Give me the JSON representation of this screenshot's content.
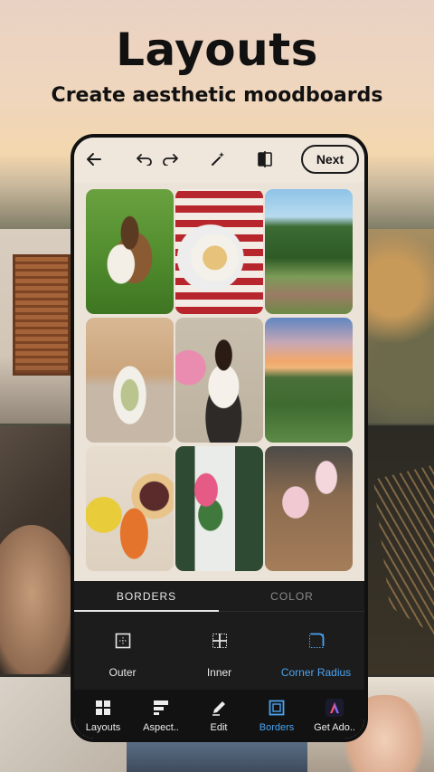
{
  "headline": "Layouts",
  "subheadline": "Create aesthetic moodboards",
  "toolbar": {
    "back_icon": "arrow-left-icon",
    "undo_icon": "undo-icon",
    "redo_icon": "redo-icon",
    "magic_icon": "magic-wand-icon",
    "compare_icon": "compare-icon",
    "next_label": "Next"
  },
  "photos": [
    "dog",
    "soup",
    "garden",
    "tea",
    "woman",
    "sunset",
    "vegetables",
    "window-flowers",
    "drinks"
  ],
  "panel_tabs": [
    {
      "label": "BORDERS",
      "active": true
    },
    {
      "label": "COLOR",
      "active": false
    }
  ],
  "border_tools": [
    {
      "label": "Outer",
      "icon": "outer-border-icon",
      "active": false
    },
    {
      "label": "Inner",
      "icon": "inner-border-icon",
      "active": false
    },
    {
      "label": "Corner Radius",
      "icon": "corner-radius-icon",
      "active": true
    }
  ],
  "bottom_nav": [
    {
      "label": "Layouts",
      "icon": "layouts-icon",
      "active": false
    },
    {
      "label": "Aspect..",
      "icon": "aspect-icon",
      "active": false
    },
    {
      "label": "Edit",
      "icon": "edit-pencil-icon",
      "active": false
    },
    {
      "label": "Borders",
      "icon": "borders-icon",
      "active": true
    },
    {
      "label": "Get Ado..",
      "icon": "adobe-express-icon",
      "active": false
    }
  ],
  "colors": {
    "accent": "#4aa3f0",
    "panel": "#1c1c1c",
    "nav": "#121212"
  }
}
